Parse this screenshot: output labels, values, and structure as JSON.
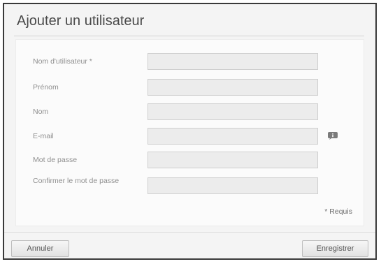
{
  "dialog": {
    "title": "Ajouter un utilisateur",
    "fields": [
      {
        "label": "Nom d'utilisateur *",
        "value": "",
        "has_info_icon": false
      },
      {
        "label": "Prénom",
        "value": "",
        "has_info_icon": false
      },
      {
        "label": "Nom",
        "value": "",
        "has_info_icon": false
      },
      {
        "label": "E-mail",
        "value": "",
        "has_info_icon": true
      },
      {
        "label": "Mot de passe",
        "value": "",
        "has_info_icon": false
      },
      {
        "label": "Confirmer le mot de passe",
        "value": "",
        "has_info_icon": false
      }
    ],
    "required_note": "* Requis",
    "info_icon": "info-bubble-icon"
  },
  "footer": {
    "cancel_label": "Annuler",
    "save_label": "Enregistrer"
  },
  "colors": {
    "dialog_border": "#3a3a3a",
    "panel_bg": "#fbfbfb",
    "input_bg": "#ececec",
    "info_icon": "#7a7a7a"
  }
}
